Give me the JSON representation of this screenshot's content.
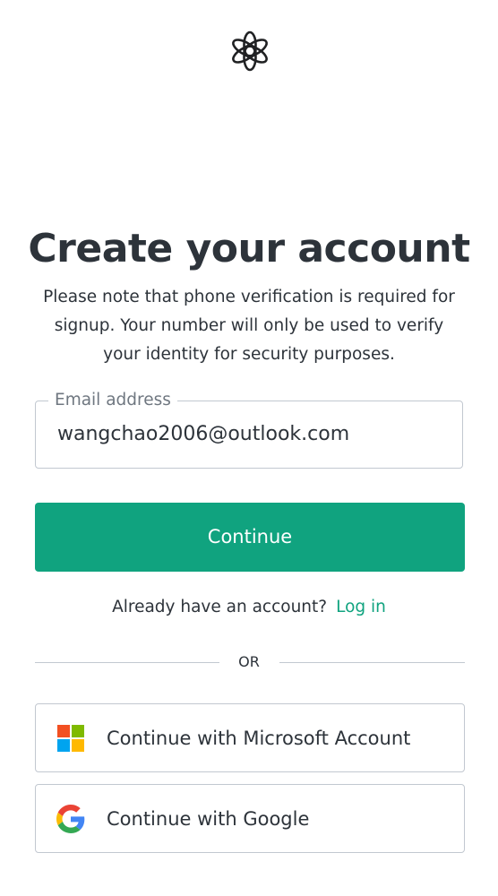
{
  "brand": {
    "logo_icon": "openai-logo-icon",
    "accent_color": "#10a37f"
  },
  "heading": {
    "title": "Create your account",
    "subtitle_lines": [
      "Please note that phone verification is required for",
      "signup. Your number will only be used to verify",
      "your identity for security purposes."
    ]
  },
  "email": {
    "label": "Email address",
    "value": "wangchao2006@outlook.com"
  },
  "continue_button": {
    "label": "Continue"
  },
  "login": {
    "prompt": "Already have an account?",
    "link_label": "Log in"
  },
  "divider": {
    "label": "OR"
  },
  "social": {
    "microsoft": {
      "label": "Continue with Microsoft Account",
      "icon": "microsoft-logo-icon"
    },
    "google": {
      "label": "Continue with Google",
      "icon": "google-logo-icon"
    }
  }
}
